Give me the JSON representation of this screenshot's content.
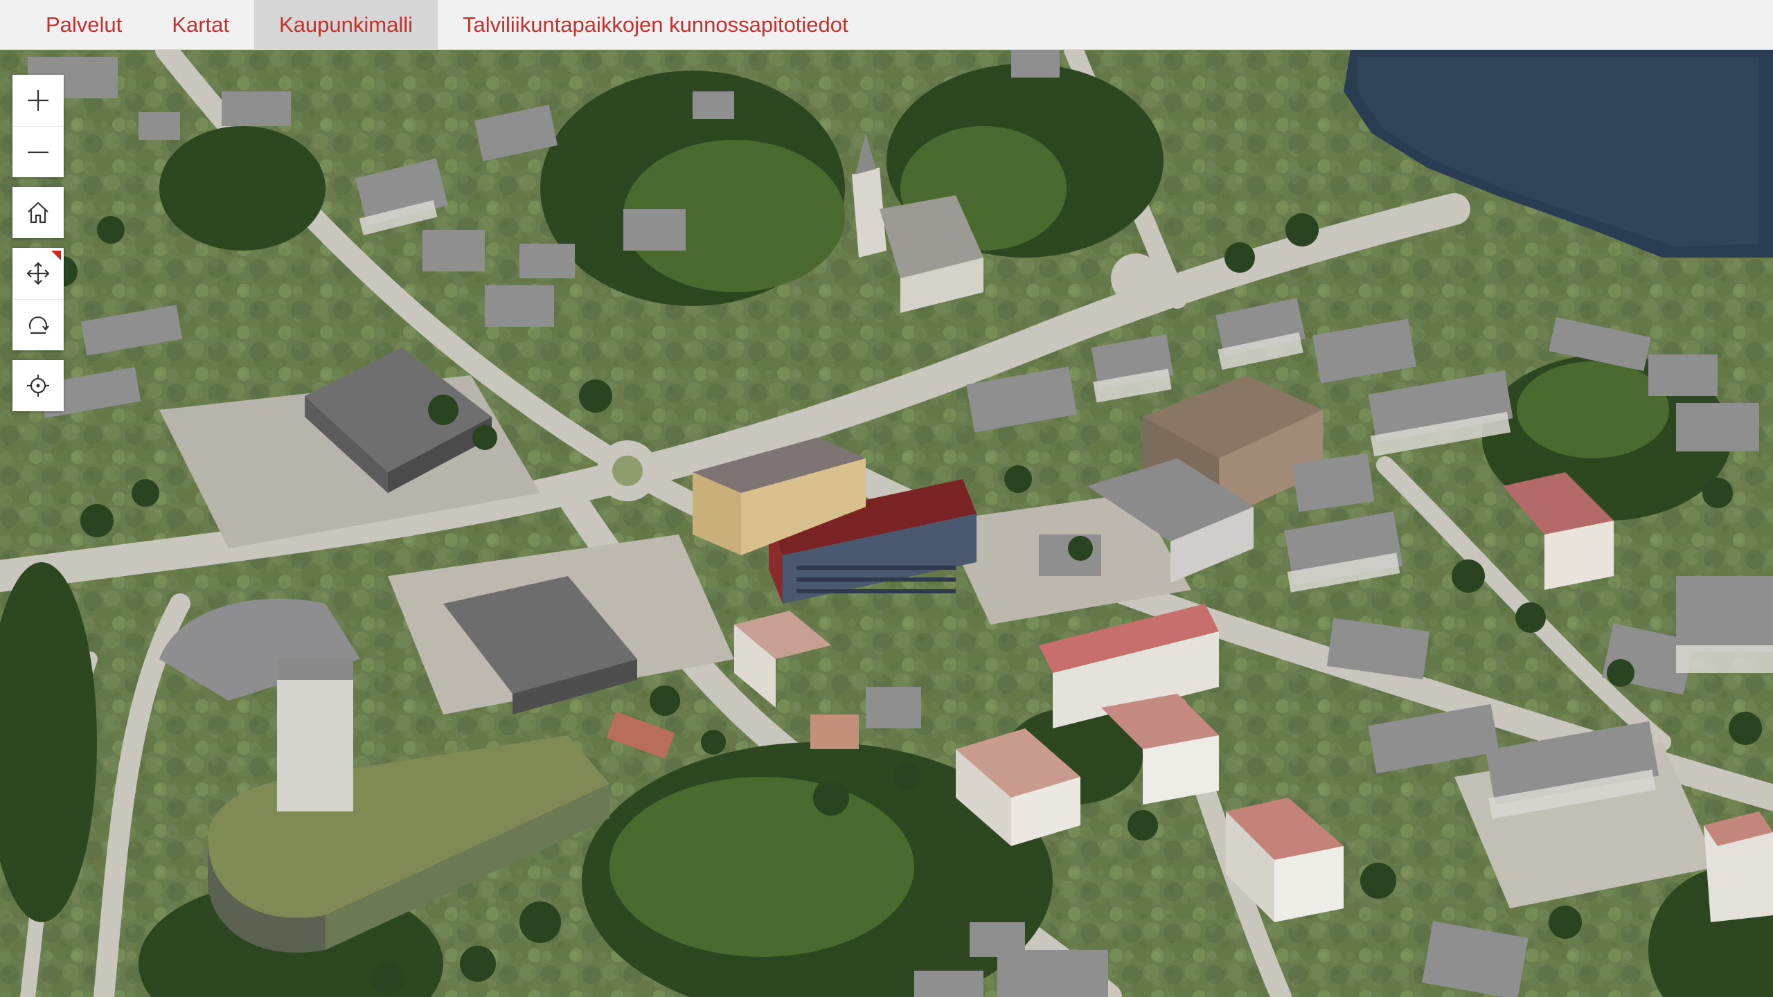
{
  "nav": {
    "tabs": [
      {
        "label": "Palvelut",
        "active": false
      },
      {
        "label": "Kartat",
        "active": false
      },
      {
        "label": "Kaupunkimalli",
        "active": true
      },
      {
        "label": "Talviliikuntapaikkojen kunnossapitotiedot",
        "active": false
      }
    ]
  },
  "map_controls": {
    "zoom_in_icon": "plus-icon",
    "zoom_out_icon": "minus-icon",
    "home_icon": "home-icon",
    "pan_icon": "move-arrows-icon",
    "rotate_icon": "rotate-icon",
    "locate_icon": "crosshair-icon"
  },
  "colors": {
    "tab_text": "#c2322e",
    "active_tab_bg": "#d6d6d6",
    "topbar_bg": "#f1f1f1",
    "pan_indicator": "#d2231f"
  }
}
